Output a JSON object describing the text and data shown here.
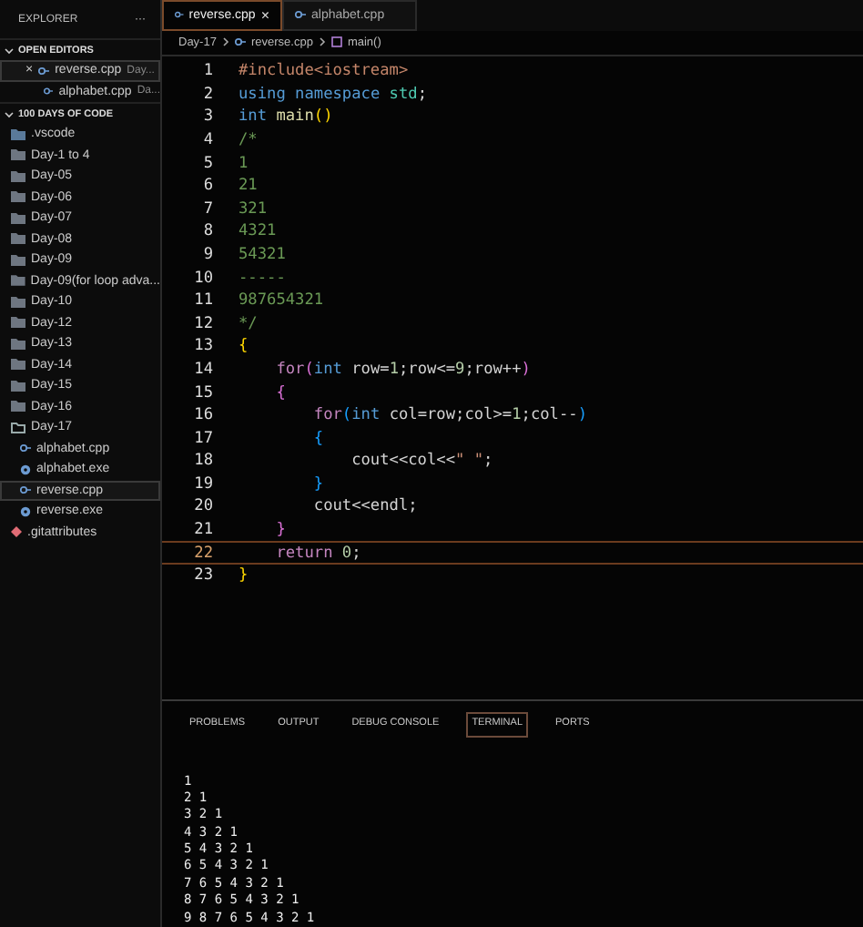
{
  "sidebar": {
    "title": "EXPLORER",
    "more": "···",
    "open_editors": {
      "title": "OPEN EDITORS",
      "expanded": true,
      "items": [
        {
          "name": "reverse.cpp",
          "folder": "Day...",
          "close": "×",
          "selected": true
        },
        {
          "name": "alphabet.cpp",
          "folder": "Da...",
          "selected": false
        }
      ]
    },
    "folder": {
      "title": "100 DAYS OF CODE",
      "expanded": true,
      "items": [
        {
          "name": ".vscode",
          "kind": "vscode",
          "selected": false
        },
        {
          "name": "Day-1 to 4",
          "kind": "folder",
          "selected": false
        },
        {
          "name": "Day-05",
          "kind": "folder",
          "selected": false
        },
        {
          "name": "Day-06",
          "kind": "folder",
          "selected": false
        },
        {
          "name": "Day-07",
          "kind": "folder",
          "selected": false
        },
        {
          "name": "Day-08",
          "kind": "folder",
          "selected": false
        },
        {
          "name": "Day-09",
          "kind": "folder",
          "selected": false
        },
        {
          "name": "Day-09(for loop adva...",
          "kind": "folder",
          "selected": false
        },
        {
          "name": "Day-10",
          "kind": "folder",
          "selected": false
        },
        {
          "name": "Day-12",
          "kind": "folder",
          "selected": false
        },
        {
          "name": "Day-13",
          "kind": "folder",
          "selected": false
        },
        {
          "name": "Day-14",
          "kind": "folder",
          "selected": false
        },
        {
          "name": "Day-15",
          "kind": "folder",
          "selected": false
        },
        {
          "name": "Day-16",
          "kind": "folder",
          "selected": false
        },
        {
          "name": "Day-17",
          "kind": "open-folder",
          "selected": false,
          "children": [
            {
              "name": "alphabet.cpp",
              "kind": "cpp",
              "selected": false
            },
            {
              "name": "alphabet.exe",
              "kind": "exe",
              "selected": false
            },
            {
              "name": "reverse.cpp",
              "kind": "cpp",
              "selected": true
            },
            {
              "name": "reverse.exe",
              "kind": "exe",
              "selected": false
            }
          ]
        },
        {
          "name": ".gitattributes",
          "kind": "git",
          "selected": false
        }
      ]
    }
  },
  "tabs": [
    {
      "label": "reverse.cpp",
      "close": "×",
      "selected": true
    },
    {
      "label": "alphabet.cpp",
      "selected": false
    }
  ],
  "breadcrumb": [
    "Day-17",
    "reverse.cpp",
    "main()"
  ],
  "code": [
    {
      "number": "1",
      "current": false,
      "tokens": [
        {
          "kind": "preproc",
          "text": "#include<iostream>"
        }
      ]
    },
    {
      "number": "2",
      "current": false,
      "tokens": [
        {
          "kind": "keyword",
          "text": "using "
        },
        {
          "kind": "keyword",
          "text": "namespace "
        },
        {
          "kind": "type",
          "text": "std"
        },
        {
          "kind": "plain",
          "text": ";"
        }
      ]
    },
    {
      "number": "3",
      "current": false,
      "tokens": [
        {
          "kind": "keyword",
          "text": "int "
        },
        {
          "kind": "func",
          "text": "main"
        },
        {
          "kind": "bracket1",
          "text": "()"
        }
      ]
    },
    {
      "number": "4",
      "current": false,
      "tokens": [
        {
          "kind": "comment",
          "text": "/*"
        }
      ]
    },
    {
      "number": "5",
      "current": false,
      "tokens": [
        {
          "kind": "comment",
          "text": "1"
        }
      ]
    },
    {
      "number": "6",
      "current": false,
      "tokens": [
        {
          "kind": "comment",
          "text": "21"
        }
      ]
    },
    {
      "number": "7",
      "current": false,
      "tokens": [
        {
          "kind": "comment",
          "text": "321"
        }
      ]
    },
    {
      "number": "8",
      "current": false,
      "tokens": [
        {
          "kind": "comment",
          "text": "4321"
        }
      ]
    },
    {
      "number": "9",
      "current": false,
      "tokens": [
        {
          "kind": "comment",
          "text": "54321"
        }
      ]
    },
    {
      "number": "10",
      "current": false,
      "tokens": [
        {
          "kind": "comment",
          "text": "-----"
        }
      ]
    },
    {
      "number": "11",
      "current": false,
      "tokens": [
        {
          "kind": "comment",
          "text": "987654321"
        }
      ]
    },
    {
      "number": "12",
      "current": false,
      "tokens": [
        {
          "kind": "comment",
          "text": "*/"
        }
      ]
    },
    {
      "number": "13",
      "current": false,
      "tokens": [
        {
          "kind": "bracket1",
          "text": "{"
        }
      ]
    },
    {
      "number": "14",
      "current": false,
      "tokens": [
        {
          "kind": "control",
          "text": "    for"
        },
        {
          "kind": "bracket2",
          "text": "("
        },
        {
          "kind": "keyword",
          "text": "int "
        },
        {
          "kind": "plain",
          "text": "row="
        },
        {
          "kind": "number",
          "text": "1"
        },
        {
          "kind": "plain",
          "text": ";row<="
        },
        {
          "kind": "number",
          "text": "9"
        },
        {
          "kind": "plain",
          "text": ";row++"
        },
        {
          "kind": "bracket2",
          "text": ")"
        }
      ]
    },
    {
      "number": "15",
      "current": false,
      "tokens": [
        {
          "kind": "bracket2",
          "text": "    {"
        }
      ]
    },
    {
      "number": "16",
      "current": false,
      "tokens": [
        {
          "kind": "control",
          "text": "        for"
        },
        {
          "kind": "bracket3",
          "text": "("
        },
        {
          "kind": "keyword",
          "text": "int "
        },
        {
          "kind": "plain",
          "text": "col=row;col>="
        },
        {
          "kind": "number",
          "text": "1"
        },
        {
          "kind": "plain",
          "text": ";col--"
        },
        {
          "kind": "bracket3",
          "text": ")"
        }
      ]
    },
    {
      "number": "17",
      "current": false,
      "tokens": [
        {
          "kind": "bracket3",
          "text": "        {"
        }
      ]
    },
    {
      "number": "18",
      "current": false,
      "tokens": [
        {
          "kind": "plain",
          "text": "            cout<<col<<"
        },
        {
          "kind": "string",
          "text": "\" \""
        },
        {
          "kind": "plain",
          "text": ";"
        }
      ]
    },
    {
      "number": "19",
      "current": false,
      "tokens": [
        {
          "kind": "bracket3",
          "text": "        }"
        }
      ]
    },
    {
      "number": "20",
      "current": false,
      "tokens": [
        {
          "kind": "plain",
          "text": "        cout<<endl;"
        }
      ]
    },
    {
      "number": "21",
      "current": false,
      "tokens": [
        {
          "kind": "bracket2",
          "text": "    }"
        }
      ]
    },
    {
      "number": "22",
      "current": true,
      "tokens": [
        {
          "kind": "control",
          "text": "    return "
        },
        {
          "kind": "number",
          "text": "0"
        },
        {
          "kind": "plain",
          "text": ";"
        }
      ]
    },
    {
      "number": "23",
      "current": false,
      "tokens": [
        {
          "kind": "bracket1",
          "text": "}"
        }
      ]
    }
  ],
  "panel": {
    "tabs": [
      {
        "label": "PROBLEMS",
        "selected": false
      },
      {
        "label": "OUTPUT",
        "selected": false
      },
      {
        "label": "DEBUG CONSOLE",
        "selected": false
      },
      {
        "label": "TERMINAL",
        "selected": true
      },
      {
        "label": "PORTS",
        "selected": false
      }
    ],
    "terminal": [
      "1",
      "2 1",
      "3 2 1",
      "4 3 2 1",
      "5 4 3 2 1",
      "6 5 4 3 2 1",
      "7 6 5 4 3 2 1",
      "8 7 6 5 4 3 2 1",
      "9 8 7 6 5 4 3 2 1"
    ]
  }
}
